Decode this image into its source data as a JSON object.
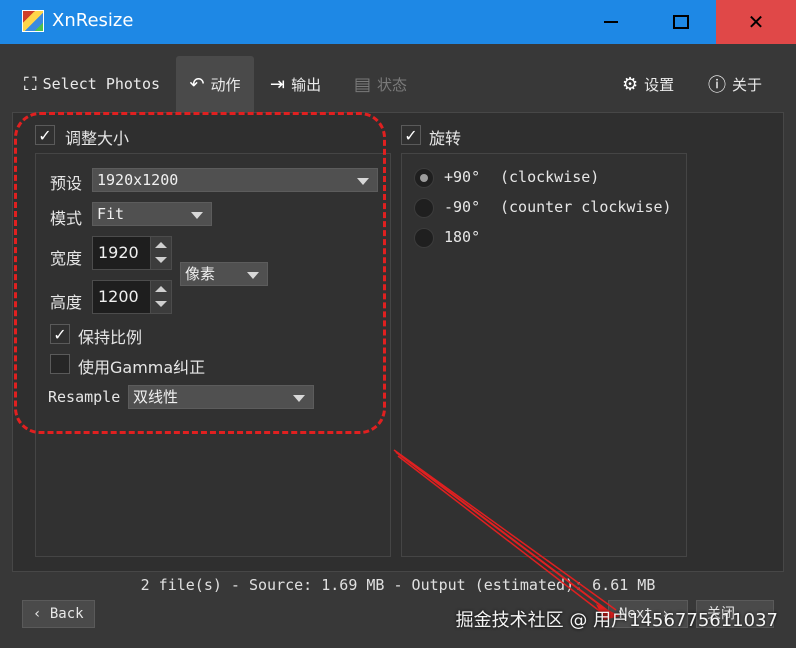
{
  "window": {
    "title": "XnResize"
  },
  "tabs": [
    {
      "label": "Select Photos",
      "icon": "select-photos-icon"
    },
    {
      "label": "动作",
      "icon": "undo-arrow-icon"
    },
    {
      "label": "输出",
      "icon": "output-icon"
    },
    {
      "label": "状态",
      "icon": "clipboard-icon"
    },
    {
      "label": "设置",
      "icon": "gear-icon"
    },
    {
      "label": "关于",
      "icon": "info-icon"
    }
  ],
  "resize": {
    "enabled_label": "调整大小",
    "preset_label": "预设",
    "preset_value": "1920x1200",
    "mode_label": "模式",
    "mode_value": "Fit",
    "width_label": "宽度",
    "width_value": "1920",
    "height_label": "高度",
    "height_value": "1200",
    "unit_value": "像素",
    "keep_ratio_label": "保持比例",
    "gamma_label": "使用Gamma纠正",
    "resample_label": "Resample",
    "resample_value": "双线性"
  },
  "rotate": {
    "enabled_label": "旋转",
    "options": [
      {
        "angle": "+90°",
        "desc": "(clockwise)",
        "selected": true
      },
      {
        "angle": "-90°",
        "desc": "(counter clockwise)",
        "selected": false
      },
      {
        "angle": "180°",
        "desc": "",
        "selected": false
      }
    ]
  },
  "status_text": "2 file(s) - Source: 1.69 MB - Output (estimated): 6.61 MB",
  "buttons": {
    "back": "Back",
    "next": "Next",
    "close": "关闭"
  },
  "watermark": "掘金技术社区 @ 用户1456775611037",
  "colors": {
    "titlebar": "#1e88e5",
    "close": "#e04848",
    "annotation": "#e02020"
  }
}
